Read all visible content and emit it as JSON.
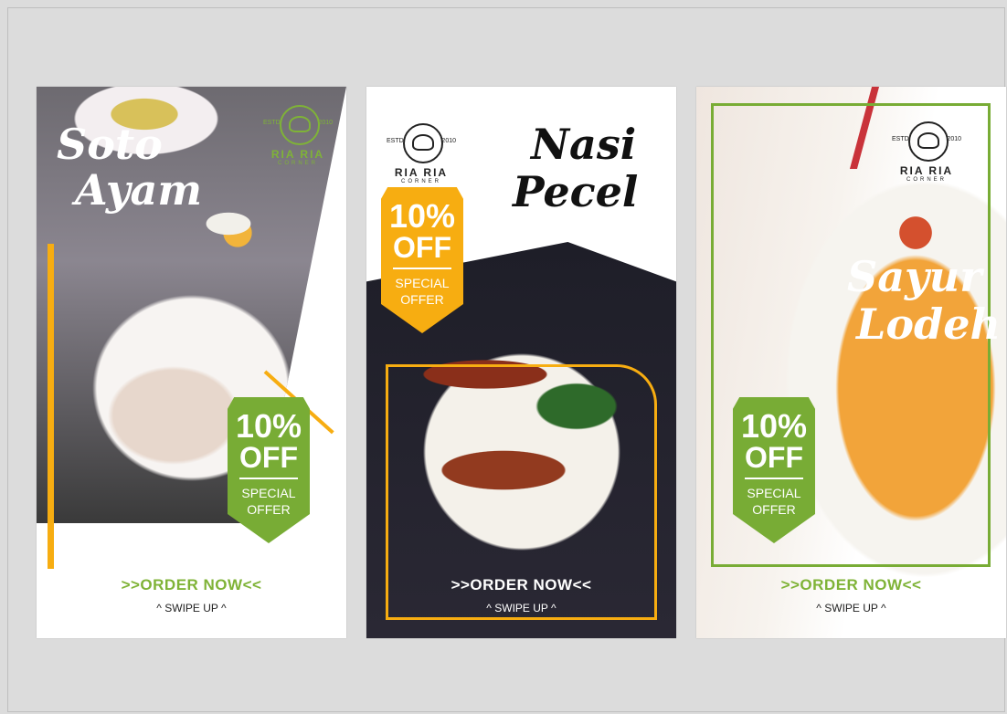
{
  "cards": [
    {
      "title_line1": "Soto",
      "title_line2": "Ayam",
      "logo": {
        "estd": "ESTD",
        "year": "2010",
        "name": "RIA RIA",
        "sub": "CORNER"
      },
      "badge": {
        "pct": "10%",
        "off": "OFF",
        "special": "SPECIAL",
        "offer": "OFFER",
        "color": "#78ac35"
      },
      "order": ">>ORDER NOW<<",
      "swipe": "^ SWIPE UP ^"
    },
    {
      "title_line1": "Nasi",
      "title_line2": "Pecel",
      "logo": {
        "estd": "ESTD",
        "year": "2010",
        "name": "RIA RIA",
        "sub": "CORNER"
      },
      "badge": {
        "pct": "10%",
        "off": "OFF",
        "special": "SPECIAL",
        "offer": "OFFER",
        "color": "#f7ad11"
      },
      "order": ">>ORDER NOW<<",
      "swipe": "^ SWIPE UP ^"
    },
    {
      "title_line1": "Sayur",
      "title_line2": "Lodeh",
      "logo": {
        "estd": "ESTD",
        "year": "2010",
        "name": "RIA RIA",
        "sub": "CORNER"
      },
      "badge": {
        "pct": "10%",
        "off": "OFF",
        "special": "SPECIAL",
        "offer": "OFFER",
        "color": "#78ac35"
      },
      "order": ">>ORDER NOW<<",
      "swipe": "^ SWIPE UP ^"
    }
  ],
  "colors": {
    "brand_green": "#78ac35",
    "brand_orange": "#f7ad11",
    "canvas_bg": "#dcdcdc"
  }
}
